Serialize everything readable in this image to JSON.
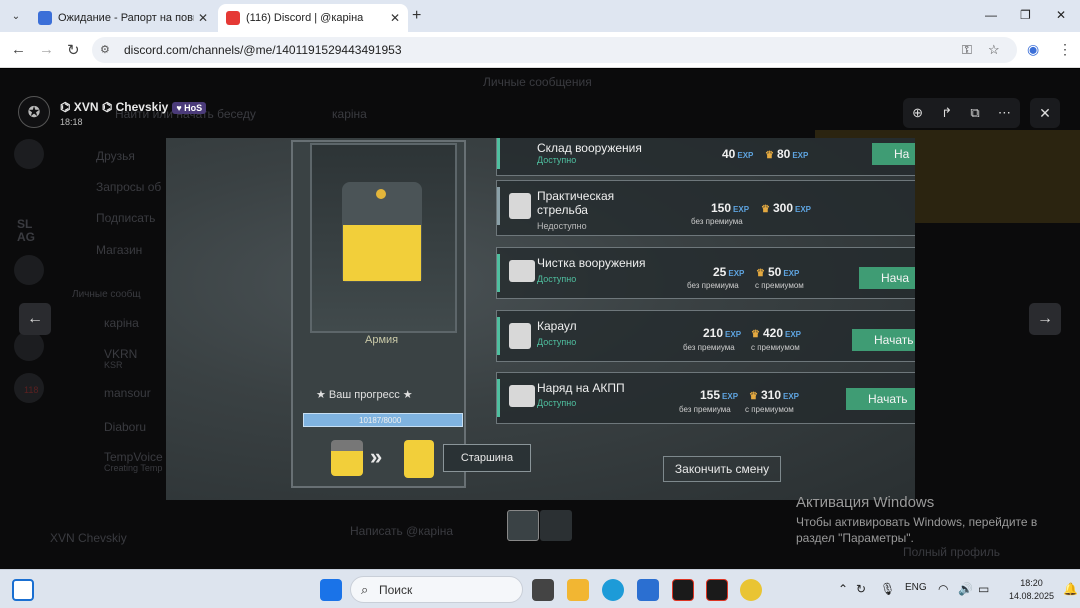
{
  "browser": {
    "tabs": [
      {
        "title": "Ожидание - Рапорт на повыш",
        "favicon_color": "#3b6fd8"
      },
      {
        "title": "(116) Discord | @каріна",
        "favicon_color": "#e53935",
        "favicon_badge": "116"
      }
    ],
    "url": "discord.com/channels/@me/1401191529443491953"
  },
  "discord_background": {
    "header_center": "Личные сообщения",
    "search_placeholder": "Найти или начать беседу",
    "nav_items": [
      "Друзья",
      "Запросы об",
      "Подписать",
      "Магазин"
    ],
    "dm_header": "Личные сообщ",
    "dms": [
      "каріна",
      "VKRN",
      "mansour",
      "Diaboru",
      "TempVoice"
    ],
    "dm_sub": [
      "",
      "KSR",
      "",
      "",
      "Creating Temp"
    ],
    "server_badge": "118",
    "user_name": "XVN Chevskiy",
    "chat_header": "каріна",
    "chat_input": "Написать @каріна",
    "profile_button": "Полный профиль",
    "side_labels": [
      "SL",
      "AG"
    ]
  },
  "viewer": {
    "author": "⌬ XVN ⌬ Chevskiy",
    "badge": "♥ HoS",
    "time": "18:18"
  },
  "game": {
    "army_label": "Армия",
    "progress_title": "★ Ваш прогресс ★",
    "progress_value": "10187/8000",
    "progress_fraction": 1.0,
    "next_rank_tooltip": "Старшина",
    "finish_button": "Закончить смену",
    "tasks": [
      {
        "name": "Склад вооружения",
        "status": "Доступно",
        "status_color": "#4fbf9f",
        "exp": "40",
        "exp_premium": "80",
        "sub_base": "",
        "sub_premium": "",
        "button": "На"
      },
      {
        "name": "Практическая стрельба",
        "status": "Недоступно",
        "status_color": "#bbbbbb",
        "exp": "150",
        "exp_premium": "300",
        "sub_base": "без премиума",
        "sub_premium": "",
        "button": ""
      },
      {
        "name": "Чистка вооружения",
        "status": "Доступно",
        "status_color": "#4fbf9f",
        "exp": "25",
        "exp_premium": "50",
        "sub_base": "без премиума",
        "sub_premium": "с премиумом",
        "button": "Нача"
      },
      {
        "name": "Караул",
        "status": "Доступно",
        "status_color": "#4fbf9f",
        "exp": "210",
        "exp_premium": "420",
        "sub_base": "без премиума",
        "sub_premium": "с премиумом",
        "button": "Начать"
      },
      {
        "name": "Наряд на АКПП",
        "status": "Доступно",
        "status_color": "#4fbf9f",
        "exp": "155",
        "exp_premium": "310",
        "sub_base": "без премиума",
        "sub_premium": "с премиумом",
        "button": "Начать"
      }
    ],
    "exp_unit": "EXP"
  },
  "windows_activation": {
    "title": "Активация Windows",
    "body": "Чтобы активировать Windows, перейдите в раздел \"Параметры\"."
  },
  "taskbar": {
    "search_label": "Поиск",
    "lang": "ENG",
    "time": "18:20",
    "date": "14.08.2025"
  }
}
